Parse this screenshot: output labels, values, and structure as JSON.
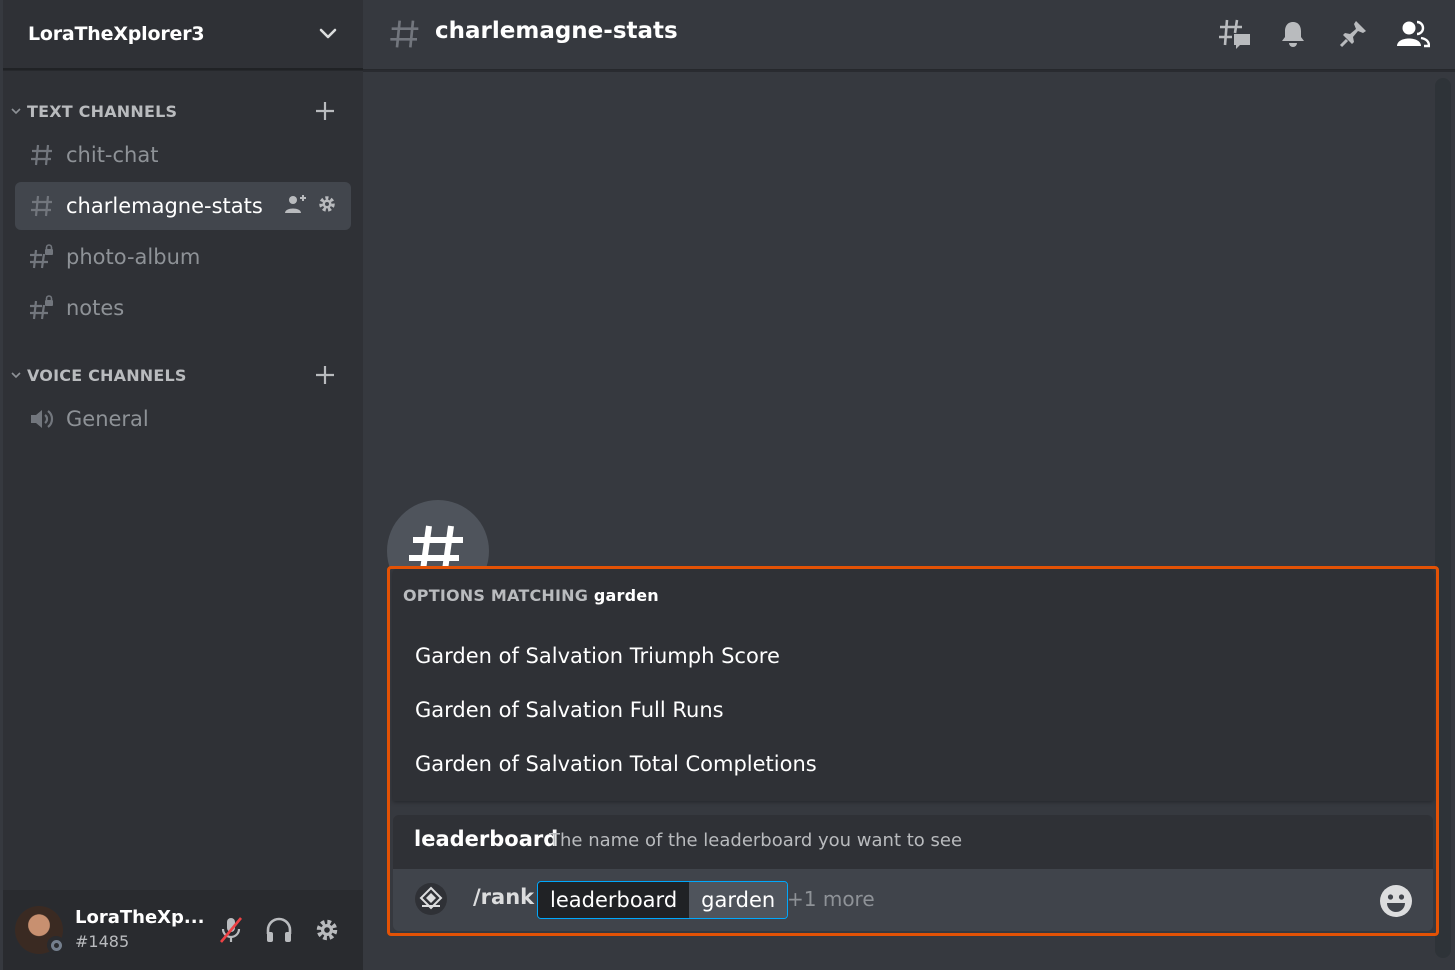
{
  "server": {
    "name": "LoraTheXplorer3"
  },
  "categories": {
    "text": {
      "label": "TEXT CHANNELS"
    },
    "voice": {
      "label": "VOICE CHANNELS"
    }
  },
  "channels": {
    "text": [
      {
        "name": "chit-chat",
        "icon": "hash-icon"
      },
      {
        "name": "charlemagne-stats",
        "icon": "hash-icon",
        "selected": true
      },
      {
        "name": "photo-album",
        "icon": "locked-hash-icon"
      },
      {
        "name": "notes",
        "icon": "locked-hash-icon"
      }
    ],
    "voice": [
      {
        "name": "General",
        "icon": "speaker-icon"
      }
    ]
  },
  "user": {
    "name": "LoraTheXp...",
    "tag": "#1485",
    "status": "offline"
  },
  "channel_header": {
    "title": "charlemagne-stats"
  },
  "autocomplete": {
    "title_prefix": "OPTIONS MATCHING",
    "query": "garden",
    "options": [
      "Garden of Salvation Triumph Score",
      "Garden of Salvation Full Runs",
      "Garden of Salvation Total Completions"
    ]
  },
  "option_info": {
    "name": "leaderboard",
    "description": "The name of the leaderboard you want to see"
  },
  "input": {
    "command": "/rank",
    "option_key": "leaderboard",
    "option_value": "garden",
    "more": "+1 more"
  },
  "colors": {
    "highlight_border": "#e35205",
    "pill_border": "#00a8fc",
    "muted_red": "#ed4245"
  }
}
